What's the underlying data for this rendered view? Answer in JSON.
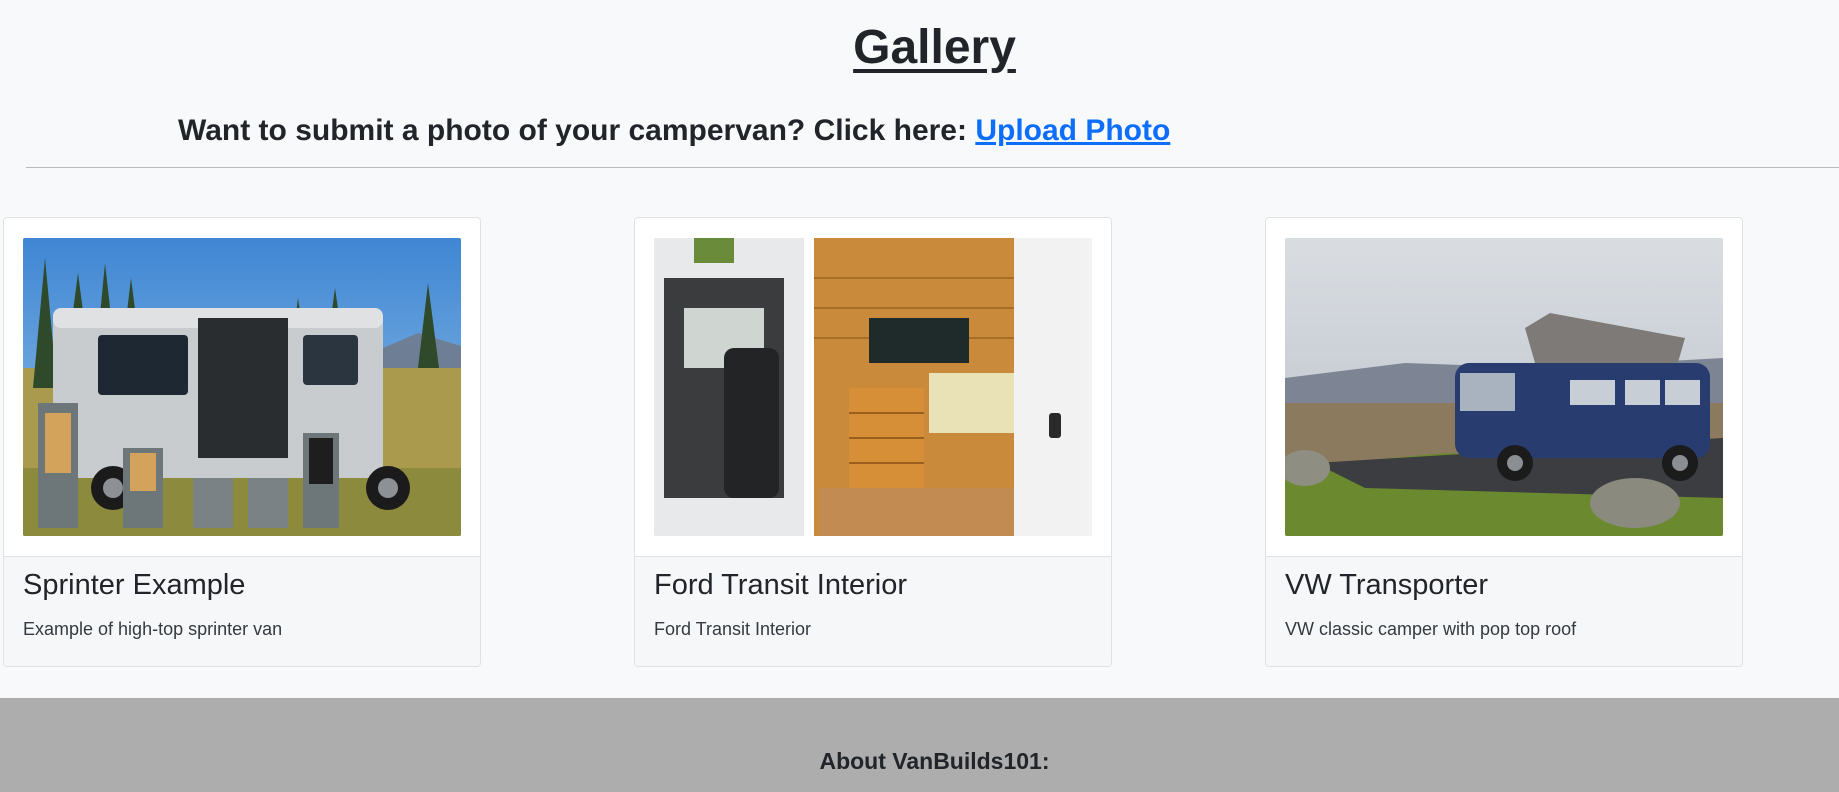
{
  "header": {
    "title": "Gallery",
    "upload_prompt": "Want to submit a photo of your campervan? Click here:",
    "upload_link": "Upload Photo"
  },
  "cards": [
    {
      "title": "Sprinter Example",
      "text": "Example of high-top sprinter van"
    },
    {
      "title": "Ford Transit Interior",
      "text": "Ford Transit Interior"
    },
    {
      "title": "VW Transporter",
      "text": "VW classic camper with pop top roof"
    }
  ],
  "footer": {
    "heading": "About VanBuilds101:"
  },
  "colors": {
    "link": "#0d6efd",
    "footer_bg": "#adadad",
    "page_bg": "#f8f9fa"
  }
}
